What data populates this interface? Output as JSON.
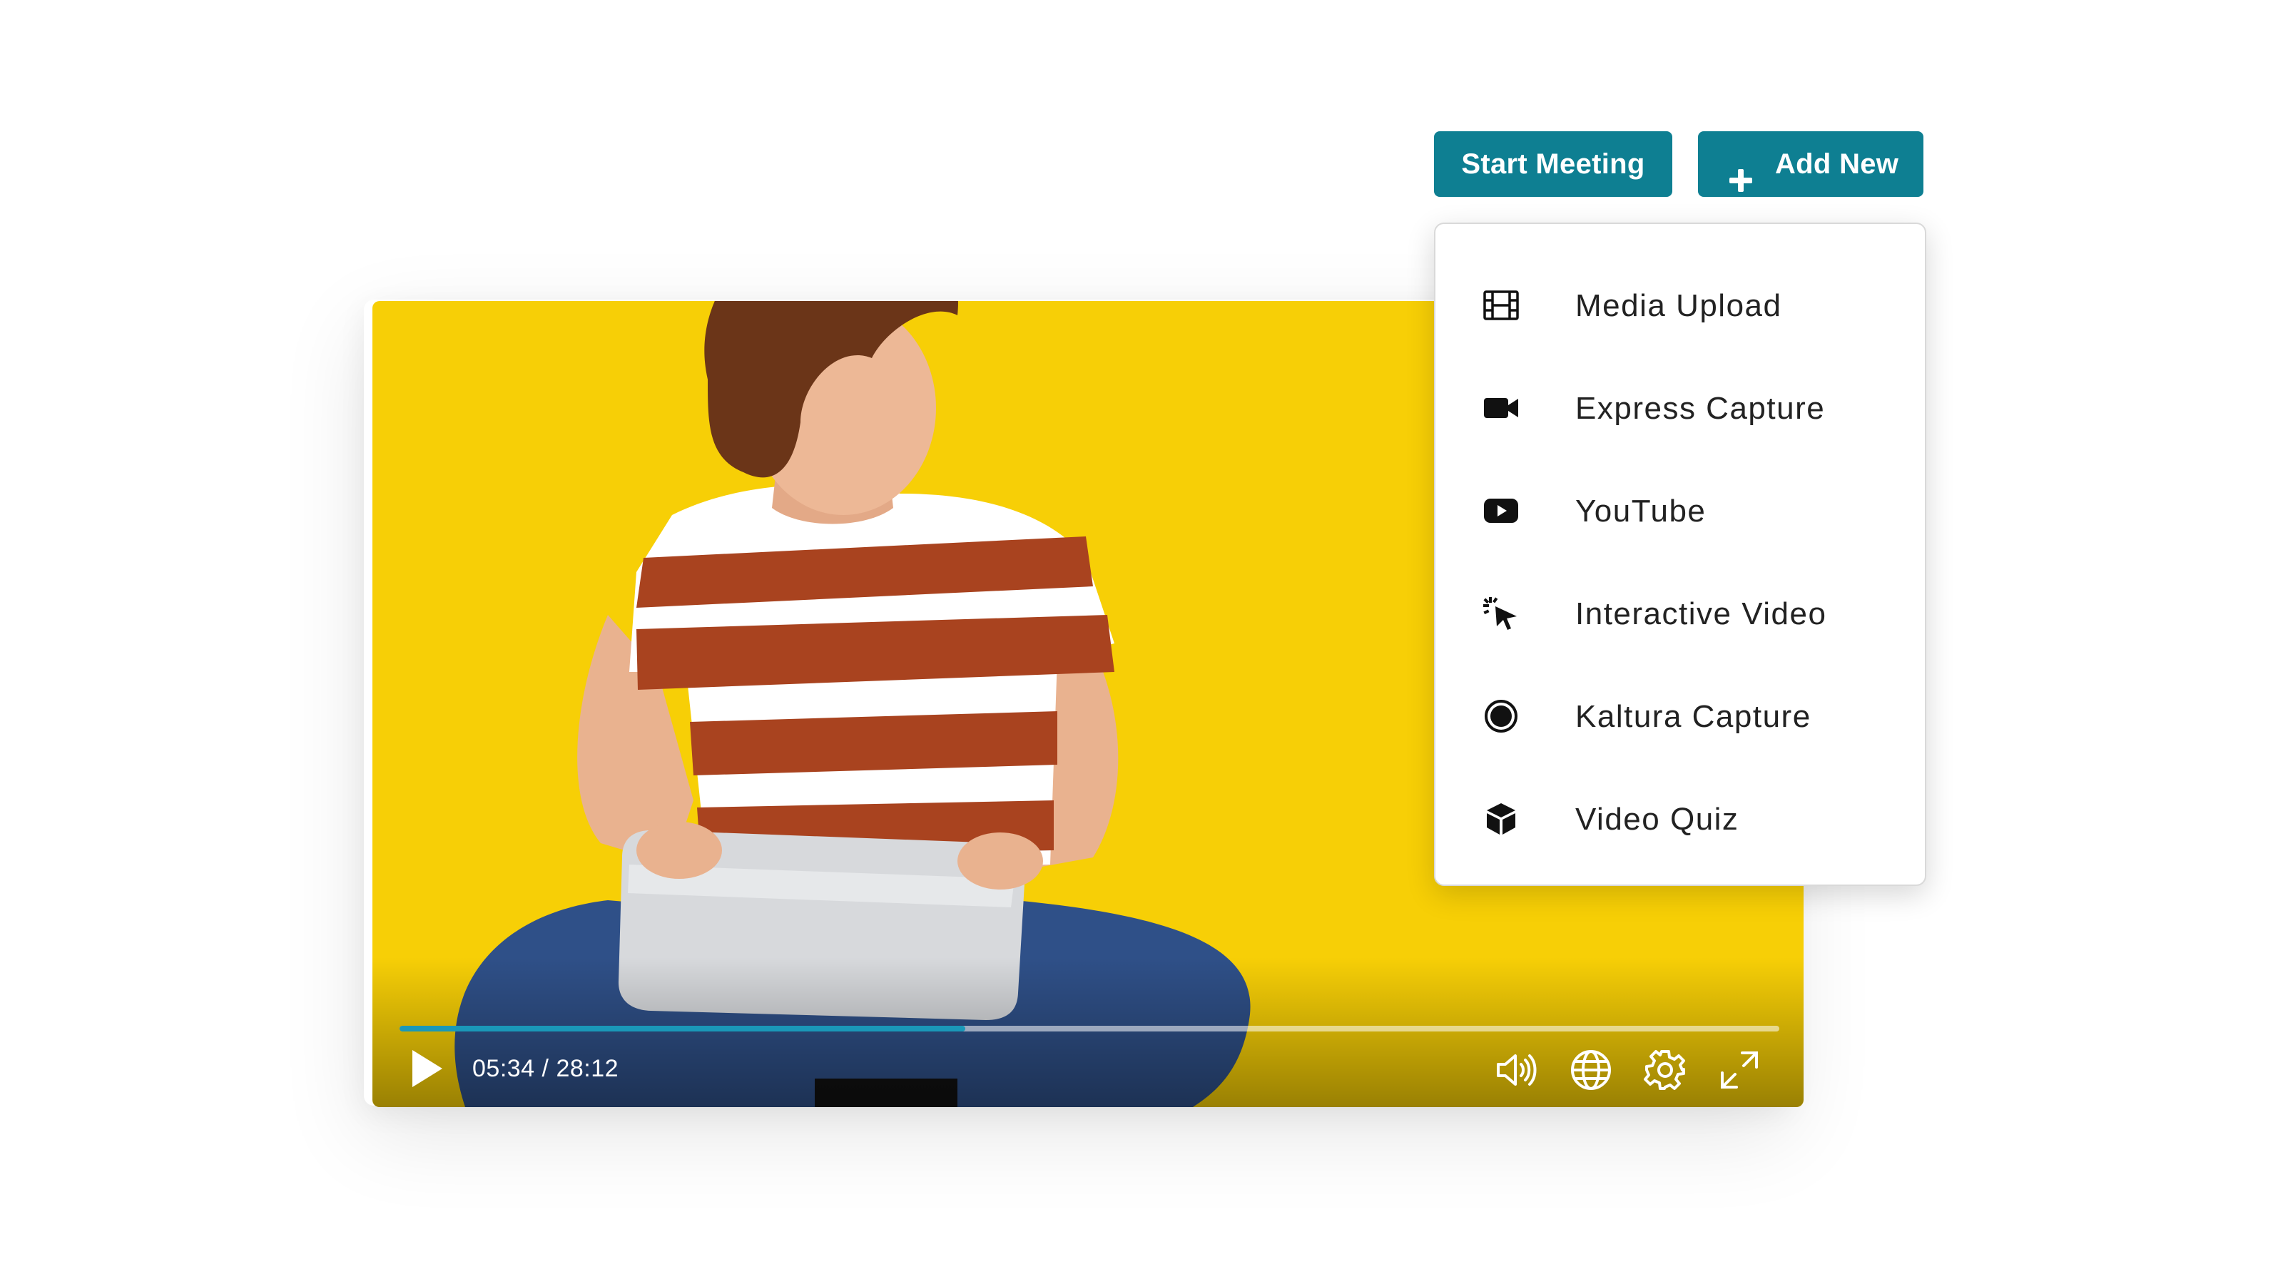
{
  "colors": {
    "accent": "#0e7f92",
    "progress": "#1a98b8",
    "video_background": "#f7cf06"
  },
  "header": {
    "start_meeting_label": "Start Meeting",
    "add_new_label": "Add New",
    "add_new_icon": "plus-icon"
  },
  "add_new_menu": {
    "items": [
      {
        "label": "Media Upload",
        "icon": "film-icon"
      },
      {
        "label": "Express Capture",
        "icon": "video-camera-icon"
      },
      {
        "label": "YouTube",
        "icon": "youtube-icon"
      },
      {
        "label": "Interactive Video",
        "icon": "click-cursor-icon"
      },
      {
        "label": "Kaltura Capture",
        "icon": "record-icon"
      },
      {
        "label": "Video Quiz",
        "icon": "cube-icon"
      }
    ]
  },
  "player": {
    "current_time": "05:34",
    "separator": "/",
    "duration": "28:12",
    "progress": 0.41,
    "controls": [
      "play-icon",
      "volume-icon",
      "language-globe-icon",
      "settings-gear-icon",
      "fullscreen-icon"
    ]
  }
}
